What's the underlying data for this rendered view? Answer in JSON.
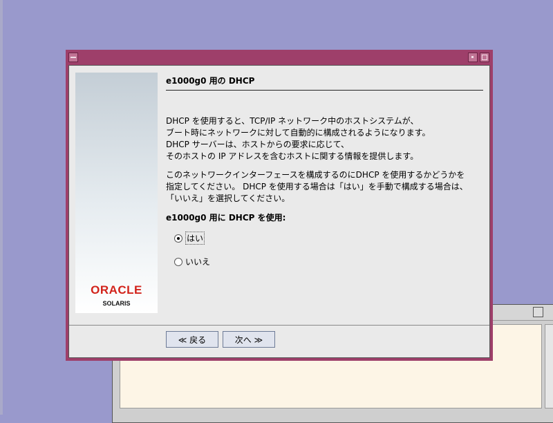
{
  "dialog": {
    "title": "e1000g0 用の DHCP",
    "paragraph1": [
      "DHCP を使用すると、TCP/IP ネットワーク中のホストシステムが、",
      "ブート時にネットワークに対して自動的に構成されるようになります。",
      "DHCP サーバーは、ホストからの要求に応じて、",
      "そのホストの IP アドレスを含むホストに関する情報を提供します。"
    ],
    "paragraph2": [
      "このネットワークインターフェースを構成するのにDHCP を使用するかどうかを",
      "指定してください。 DHCP を使用する場合は「はい」を手動で構成する場合は、",
      "「いいえ」を選択してください。"
    ],
    "question": "e1000g0 用に DHCP を使用:",
    "options": [
      {
        "label": "はい",
        "selected": true
      },
      {
        "label": "いいえ",
        "selected": false
      }
    ],
    "back_label": "≪ 戻る",
    "next_label": "次へ ≫"
  },
  "branding": {
    "oracle": "ORACLE",
    "solaris": "SOLARIS",
    "oracle_color": "#d2221a"
  },
  "colors": {
    "desktop": "#9999cc",
    "window_frame": "#9e3f6a",
    "dialog_body": "#eaeaea",
    "terminal_bg": "#fdf5e6"
  }
}
